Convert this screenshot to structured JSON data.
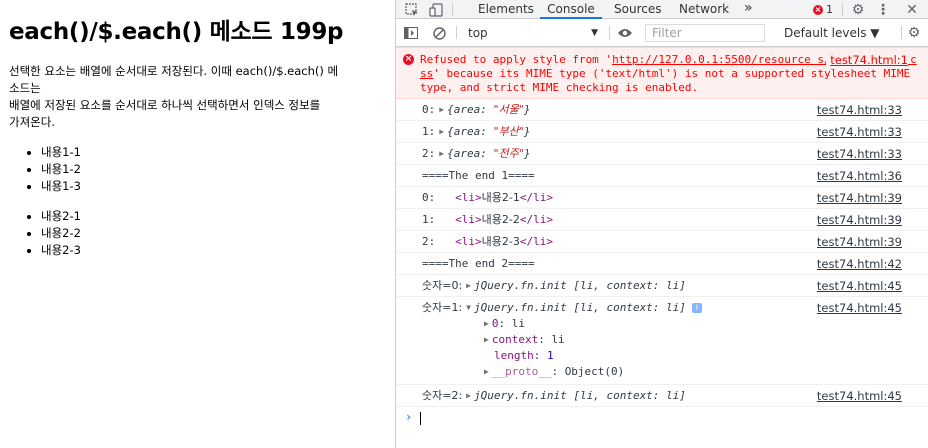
{
  "page": {
    "title": "each()/$.each() 메소드 199p",
    "paragraph_lines": [
      "선택한 요소는 배열에 순서대로 저장된다. 이때 each()/$.each() 메",
      "소드는",
      "배열에 저장된 요소를 순서대로 하나씩 선택하면서 인덱스 정보를",
      "가져온다."
    ],
    "list1": [
      "내용1-1",
      "내용1-2",
      "내용1-3"
    ],
    "list2": [
      "내용2-1",
      "내용2-2",
      "내용2-3"
    ]
  },
  "devtools": {
    "tabs": [
      "Elements",
      "Console",
      "Sources",
      "Network"
    ],
    "active_tab": "Console",
    "more_tabs": "»",
    "error_count": "1",
    "context": "top",
    "filter_placeholder": "Filter",
    "levels": "Default levels ▼",
    "icons": [
      "inspect-icon",
      "device-icon",
      "error-icon",
      "gear-icon",
      "more-icon",
      "close-icon",
      "sidebar-icon",
      "clear-icon",
      "eye-icon"
    ]
  },
  "console": {
    "error": {
      "text_pre": "Refused to apply style from '",
      "url": "http://127.0.0.1:5500/resource s/demos/style.css",
      "text_post": "' because its MIME type ('text/html') is not a supported stylesheet MIME type, and strict MIME checking is enabled.",
      "source": "test74.html:1"
    },
    "objects": [
      {
        "index": "0:",
        "key": "area",
        "value": "\"서울\"",
        "source": "test74.html:33"
      },
      {
        "index": "1:",
        "key": "area",
        "value": "\"부산\"",
        "source": "test74.html:33"
      },
      {
        "index": "2:",
        "key": "area",
        "value": "\"전주\"",
        "source": "test74.html:33"
      }
    ],
    "end1": {
      "text": "====The end 1====",
      "source": "test74.html:36"
    },
    "lis": [
      {
        "index": "0:",
        "content": "내용2-1",
        "source": "test74.html:39"
      },
      {
        "index": "1:",
        "content": "내용2-2",
        "source": "test74.html:39"
      },
      {
        "index": "2:",
        "content": "내용2-3",
        "source": "test74.html:39"
      }
    ],
    "end2": {
      "text": "====The end 2====",
      "source": "test74.html:42"
    },
    "jq0": {
      "label": "숫자=0:",
      "text": "jQuery.fn.init [li, context: li]",
      "source": "test74.html:45"
    },
    "jq1": {
      "label": "숫자=1:",
      "text": "jQuery.fn.init [li, context: li]",
      "source": "test74.html:45",
      "badge": "i",
      "props": [
        {
          "key": "0",
          "value": "li",
          "expandable": true
        },
        {
          "key": "context",
          "value": "li",
          "expandable": true
        },
        {
          "key": "length",
          "value": "1",
          "expandable": false
        },
        {
          "key": "__proto__",
          "value": "Object(0)",
          "expandable": true
        }
      ]
    },
    "jq2": {
      "label": "숫자=2:",
      "text": "jQuery.fn.init [li, context: li]",
      "source": "test74.html:45"
    },
    "prompt_symbol": "›"
  }
}
